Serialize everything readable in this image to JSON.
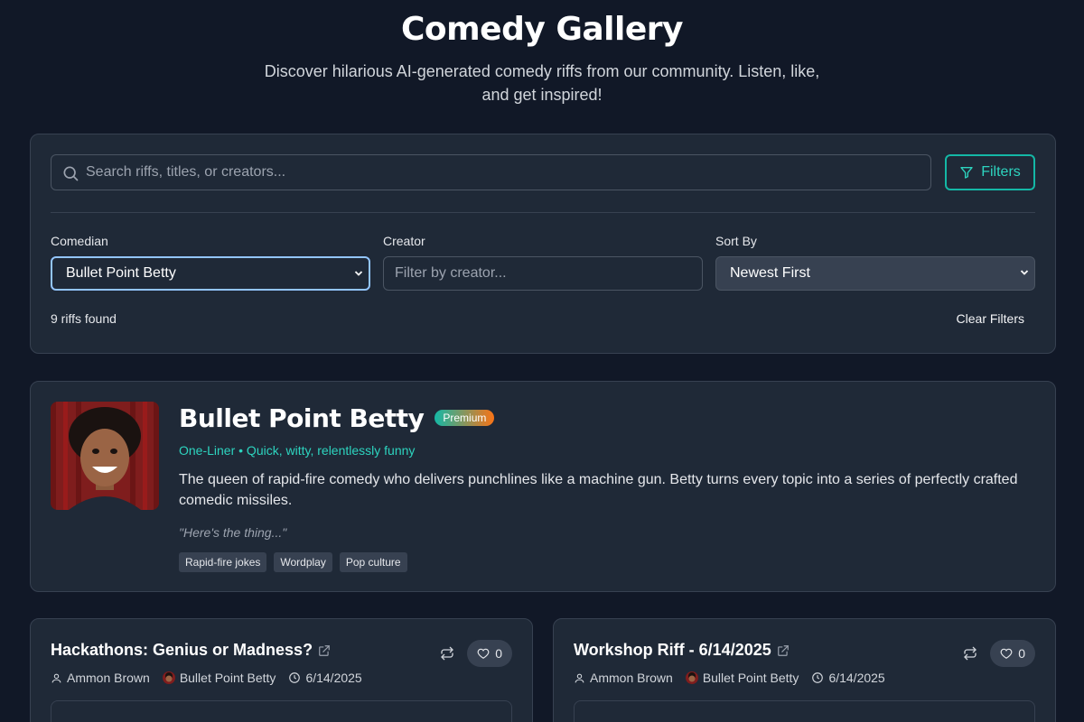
{
  "header": {
    "title": "Comedy Gallery",
    "subtitle": "Discover hilarious AI-generated comedy riffs from our community. Listen, like, and get inspired!"
  },
  "filters": {
    "search_placeholder": "Search riffs, titles, or creators...",
    "filters_label": "Filters",
    "comedian_label": "Comedian",
    "comedian_value": "Bullet Point Betty",
    "creator_label": "Creator",
    "creator_placeholder": "Filter by creator...",
    "sort_label": "Sort By",
    "sort_value": "Newest First",
    "result_count": "9 riffs found",
    "clear_label": "Clear Filters"
  },
  "comedian": {
    "name": "Bullet Point Betty",
    "badge": "Premium",
    "style": "One-Liner • Quick, witty, relentlessly funny",
    "bio": "The queen of rapid-fire comedy who delivers punchlines like a machine gun. Betty turns every topic into a series of perfectly crafted comedic missiles.",
    "catchphrase": "\"Here's the thing...\"",
    "tags": [
      "Rapid-fire jokes",
      "Wordplay",
      "Pop culture"
    ]
  },
  "riffs": [
    {
      "title": "Hackathons: Genius or Madness?",
      "likes": "0",
      "creator": "Ammon Brown",
      "comedian": "Bullet Point Betty",
      "date": "6/14/2025"
    },
    {
      "title": "Workshop Riff - 6/14/2025",
      "likes": "0",
      "creator": "Ammon Brown",
      "comedian": "Bullet Point Betty",
      "date": "6/14/2025"
    }
  ],
  "colors": {
    "background": "#111827",
    "panel": "#1f2937",
    "accent": "#2dd4bf",
    "badge_start": "#14b8a6",
    "badge_end": "#f97316"
  }
}
